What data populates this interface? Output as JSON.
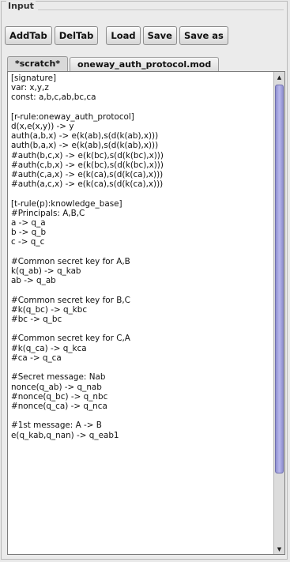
{
  "panel": {
    "title": "Input"
  },
  "toolbar": {
    "addtab_label": "AddTab",
    "deltab_label": "DelTab",
    "load_label": "Load",
    "save_label": "Save",
    "saveas_label": "Save as"
  },
  "tabs": [
    {
      "label": "*scratch*",
      "active": true
    },
    {
      "label": "oneway_auth_protocol.mod",
      "active": false
    }
  ],
  "editor": {
    "lines": [
      "[signature]",
      "var: x,y,z",
      "const: a,b,c,ab,bc,ca",
      "",
      "[r-rule:oneway_auth_protocol]",
      "d(x,e(x,y)) -> y",
      "auth(a,b,x) -> e(k(ab),s(d(k(ab),x)))",
      "auth(b,a,x) -> e(k(ab),s(d(k(ab),x)))",
      "#auth(b,c,x) -> e(k(bc),s(d(k(bc),x)))",
      "#auth(c,b,x) -> e(k(bc),s(d(k(bc),x)))",
      "#auth(c,a,x) -> e(k(ca),s(d(k(ca),x)))",
      "#auth(a,c,x) -> e(k(ca),s(d(k(ca),x)))",
      "",
      "[t-rule(p):knowledge_base]",
      "#Principals: A,B,C",
      "a -> q_a",
      "b -> q_b",
      "c -> q_c",
      "",
      "#Common secret key for A,B",
      "k(q_ab) -> q_kab",
      "ab -> q_ab",
      "",
      "#Common secret key for B,C",
      "#k(q_bc) -> q_kbc",
      "#bc -> q_bc",
      "",
      "#Common secret key for C,A",
      "#k(q_ca) -> q_kca",
      "#ca -> q_ca",
      "",
      "#Secret message: Nab",
      "nonce(q_ab) -> q_nab",
      "#nonce(q_bc) -> q_nbc",
      "#nonce(q_ca) -> q_nca",
      "",
      "#1st message: A -> B",
      "e(q_kab,q_nan) -> q_eab1"
    ]
  },
  "icons": {
    "scroll_up": "up-arrow-icon",
    "scroll_down": "down-arrow-icon"
  },
  "colors": {
    "scroll_thumb": "#a3a3e0",
    "panel_bg": "#ebebeb",
    "editor_bg": "#ffffff"
  }
}
